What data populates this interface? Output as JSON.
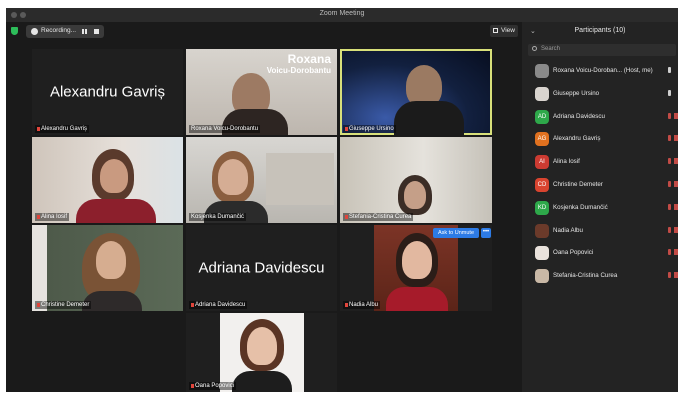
{
  "window": {
    "title": "Zoom Meeting"
  },
  "toolbar": {
    "recording_label": "Recording...",
    "view_label": "View"
  },
  "tiles": [
    {
      "name": "Alexandru Gavriș",
      "display": "Alexandru Gavriș",
      "muted": true
    },
    {
      "name": "Roxana Voicu-Dorobantu",
      "overlay_line1": "Roxana",
      "overlay_line2": "Voicu-Dorobantu",
      "muted": false
    },
    {
      "name": "Giuseppe Ursino",
      "muted": true,
      "active_speaker": true
    },
    {
      "name": "Alina Iosif",
      "muted": true
    },
    {
      "name": "Kosjenka Dumančić",
      "muted": false
    },
    {
      "name": "Stefania-Cristina Curea",
      "muted": true
    },
    {
      "name": "Christine Demeter",
      "muted": true
    },
    {
      "name": "Adriana Davidescu",
      "display": "Adriana Davidescu",
      "muted": true
    },
    {
      "name": "Nadia Albu",
      "muted": true,
      "ask_to_unmute": "Ask to Unmute",
      "more": "•••"
    },
    {
      "name": "Oana Popovici",
      "muted": true
    }
  ],
  "panel": {
    "title": "Participants (10)",
    "search_placeholder": "Search",
    "participants": [
      {
        "initials": "",
        "name": "Roxana Voicu-Doroban... (Host, me)",
        "avatar_color": "#8a8a8a",
        "mic": "on"
      },
      {
        "initials": "",
        "name": "Giuseppe Ursino",
        "avatar_color": "#d9d4cf",
        "mic": "on"
      },
      {
        "initials": "AD",
        "name": "Adriana Davidescu",
        "avatar_color": "#2ea84a",
        "mic": "muted"
      },
      {
        "initials": "AG",
        "name": "Alexandru Gavriș",
        "avatar_color": "#e0711f",
        "mic": "muted"
      },
      {
        "initials": "AI",
        "name": "Alina Iosif",
        "avatar_color": "#cc3b32",
        "mic": "muted"
      },
      {
        "initials": "CD",
        "name": "Christine Demeter",
        "avatar_color": "#d9442f",
        "mic": "muted"
      },
      {
        "initials": "KD",
        "name": "Kosjenka Dumančić",
        "avatar_color": "#2ea84a",
        "mic": "muted"
      },
      {
        "initials": "",
        "name": "Nadia Albu",
        "avatar_color": "#6b3a2a",
        "mic": "muted"
      },
      {
        "initials": "",
        "name": "Oana Popovici",
        "avatar_color": "#e9e2dc",
        "mic": "muted"
      },
      {
        "initials": "",
        "name": "Stefania-Cristina Curea",
        "avatar_color": "#c9b8a6",
        "mic": "muted"
      }
    ]
  },
  "colors": {
    "active_border": "#d8e07a",
    "muted_red": "#e0453b",
    "accent_blue": "#2d7be5",
    "shield_green": "#2dbd5a"
  }
}
